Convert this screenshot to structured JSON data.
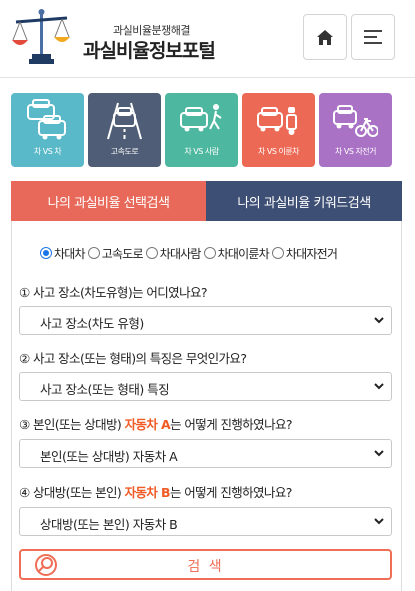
{
  "header": {
    "brand_sub": "과실비율분쟁해결",
    "brand_title": "과실비율정보포털",
    "home_icon": "home-icon",
    "menu_icon": "hamburger-menu-icon"
  },
  "categories": [
    {
      "label": "차 VS 차",
      "color": "#5ab9c8",
      "icon": "car-vs-car-icon"
    },
    {
      "label": "고속도로",
      "color": "#4f5e76",
      "icon": "highway-icon"
    },
    {
      "label": "차 VS 사람",
      "color": "#4eb79f",
      "icon": "car-vs-pedestrian-icon"
    },
    {
      "label": "차 VS 이륜차",
      "color": "#ec6a55",
      "icon": "car-vs-motorcycle-icon"
    },
    {
      "label": "차 VS 자전거",
      "color": "#a972c4",
      "icon": "car-vs-bicycle-icon"
    }
  ],
  "tabs": {
    "selection_search": "나의 과실비율 선택검색",
    "keyword_search": "나의 과실비율 키워드검색"
  },
  "accident_types": {
    "selected": "차대차",
    "options": [
      "차대차",
      "고속도로",
      "차대사람",
      "차대이륜차",
      "차대자전거"
    ]
  },
  "questions": {
    "q1": {
      "text": "① 사고 장소(차도유형)는 어디였나요?",
      "value": "사고 장소(차도 유형)"
    },
    "q2": {
      "text": "② 사고 장소(또는 형태)의 특징은 무엇인가요?",
      "value": "사고 장소(또는 형태) 특징"
    },
    "q3": {
      "pre": "③ 본인(또는 상대방) ",
      "highlight": "자동차 A",
      "post": "는 어떻게 진행하였나요?",
      "value": "본인(또는 상대방) 자동차 A"
    },
    "q4": {
      "pre": "④ 상대방(또는 본인) ",
      "highlight": "자동차 B",
      "post": "는 어떻게 진행하였나요?",
      "value": "상대방(또는 본인) 자동차 B"
    }
  },
  "search_button": {
    "label": "검 색"
  },
  "colors": {
    "accent": "#e8695a",
    "tab_inactive": "#3d4f74",
    "highlight": "#f05a24",
    "radio_selected": "#1a73e8"
  }
}
